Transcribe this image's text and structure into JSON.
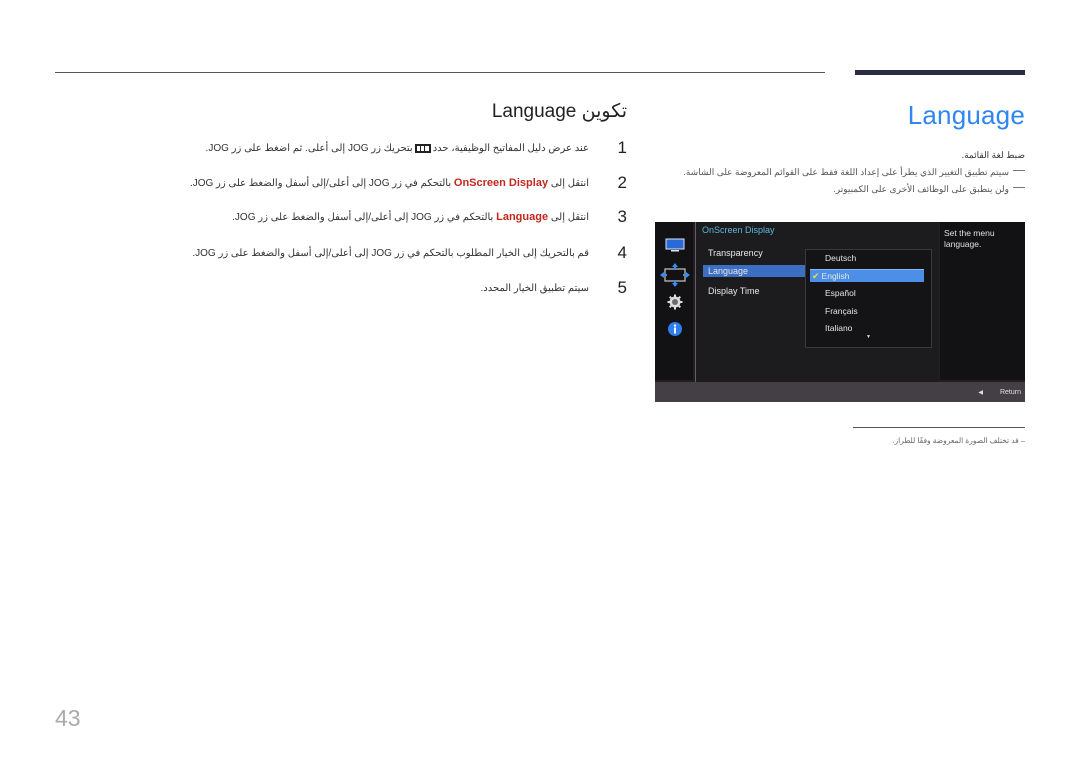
{
  "page": {
    "number": "43"
  },
  "right_column": {
    "title": "Language",
    "lead": "ضبط لغة القائمة.",
    "notes": [
      "سيتم تطبيق التغيير الذي يطرأ على إعداد اللغة فقط على القوائم المعروضة على الشاشة.",
      "ولن ينطبق على الوظائف الأخرى على الكمبيوتر."
    ],
    "footnote": "– قد تختلف الصورة المعروضة وفقًا للطراز."
  },
  "osd": {
    "title": "OnScreen Display",
    "side_icons": [
      "monitor-icon",
      "resize-arrows-icon",
      "gear-icon",
      "info-icon"
    ],
    "menu_items": [
      {
        "label": "Transparency",
        "selected": false
      },
      {
        "label": "Language",
        "selected": true
      },
      {
        "label": "Display Time",
        "selected": false
      }
    ],
    "languages": [
      {
        "label": "Deutsch",
        "selected": false
      },
      {
        "label": "English",
        "selected": true
      },
      {
        "label": "Español",
        "selected": false
      },
      {
        "label": "Français",
        "selected": false
      },
      {
        "label": "Italiano",
        "selected": false
      }
    ],
    "help_text": "Set the menu language.",
    "return_label": "Return",
    "colors": {
      "selected_menu": "#3a6fc4",
      "selected_option": "#4d8fe6",
      "title": "#5fb6df",
      "check": "#f0e040"
    }
  },
  "left_column": {
    "title": "تكوين Language",
    "steps": [
      {
        "num": "1",
        "before": "عند عرض دليل المفاتيح الوظيفية، حدد",
        "highlight": "",
        "after": "بتحريك زر JOG إلى أعلى. ثم اضغط على زر JOG."
      },
      {
        "num": "2",
        "before": "انتقل إلى",
        "highlight": "OnScreen Display",
        "after": "بالتحكم في زر JOG إلى أعلى/إلى أسفل والضغط على زر JOG."
      },
      {
        "num": "3",
        "before": "انتقل إلى",
        "highlight": "Language",
        "after": "بالتحكم في زر JOG إلى أعلى/إلى أسفل والضغط على زر JOG."
      },
      {
        "num": "4",
        "before": "قم بالتحريك إلى الخيار المطلوب بالتحكم في زر JOG إلى أعلى/إلى أسفل والضغط على زر JOG.",
        "highlight": "",
        "after": ""
      },
      {
        "num": "5",
        "before": "سيتم تطبيق الخيار المحدد.",
        "highlight": "",
        "after": ""
      }
    ],
    "highlight_color": "#c2281e"
  }
}
